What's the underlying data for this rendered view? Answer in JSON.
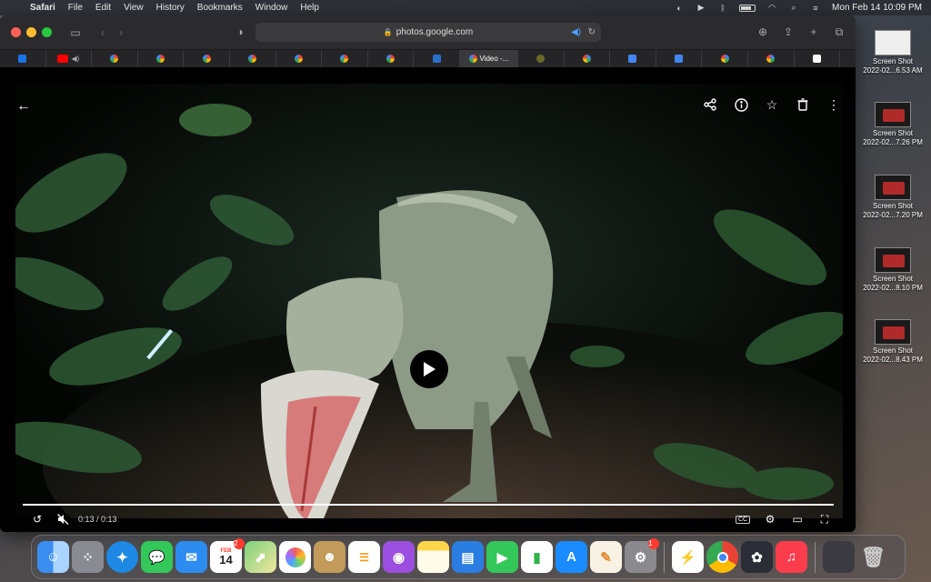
{
  "menubar": {
    "app": "Safari",
    "items": [
      "File",
      "Edit",
      "View",
      "History",
      "Bookmarks",
      "Window",
      "Help"
    ],
    "datetime": "Mon Feb 14  10:09 PM"
  },
  "browser": {
    "url": "photos.google.com",
    "active_tab_label": "Video -...",
    "tab_icons": [
      "calendar-icon",
      "youtube-icon",
      "photos-icon",
      "photos-icon",
      "photos-icon",
      "photos-icon",
      "photos-icon",
      "photos-icon",
      "photos-icon",
      "word-icon",
      "photos-icon",
      "spinner-icon",
      "google-icon",
      "docs-icon",
      "docs-icon",
      "google-icon",
      "google-icon",
      "wikipedia-icon"
    ]
  },
  "video": {
    "time": "0:13 / 0:13",
    "progress": 1.0,
    "cc_label": "CC"
  },
  "desktop": {
    "files": [
      {
        "name": "Screen Shot",
        "sub": "2022-02...6.53 AM"
      },
      {
        "name": "Screen Shot",
        "sub": "2022-02...7.26 PM"
      },
      {
        "name": "Screen Shot",
        "sub": "2022-02...7.20 PM"
      },
      {
        "name": "Screen Shot",
        "sub": "2022-02...8.10 PM"
      },
      {
        "name": "Screen Shot",
        "sub": "2022-02...8.43 PM"
      }
    ]
  },
  "dock": {
    "calendar_month": "FEB",
    "calendar_day": "14",
    "calendar_badge": "2",
    "settings_badge": "1"
  },
  "colors": {
    "accent": "#4aa3ff",
    "badge": "#ff3b30"
  }
}
